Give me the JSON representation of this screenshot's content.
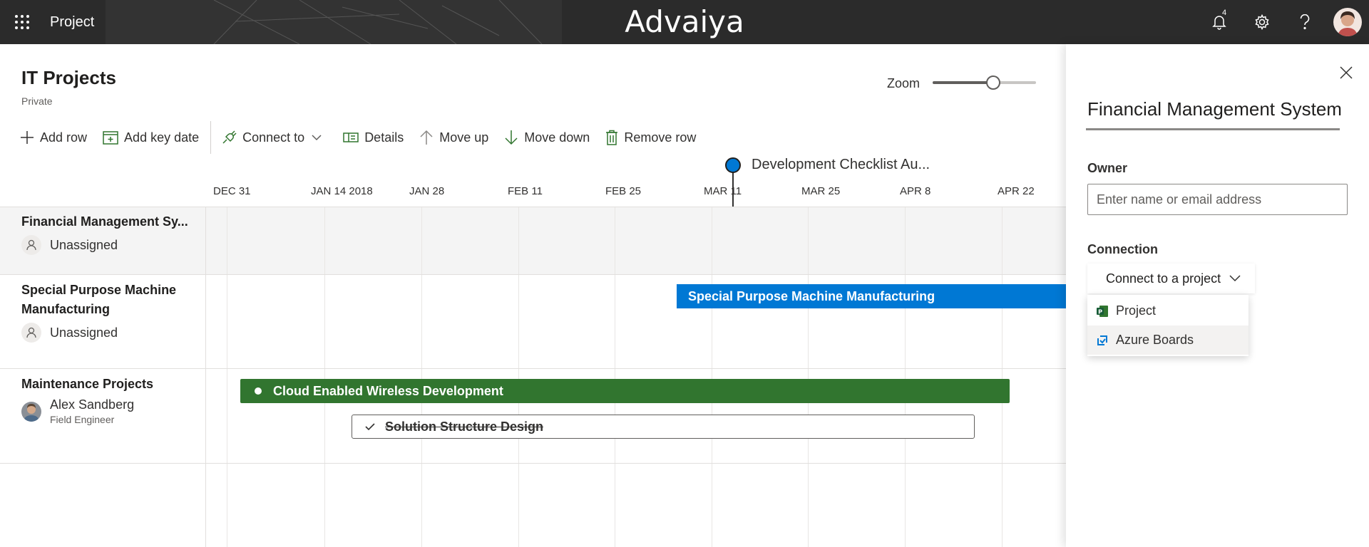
{
  "app": {
    "name": "Project",
    "logo": "Advaiya",
    "notification_count": "4"
  },
  "header": {
    "title": "IT Projects",
    "subtitle": "Private",
    "zoom_label": "Zoom",
    "zoom_level": 0.6
  },
  "toolbar": {
    "add_row": "Add row",
    "add_key_date": "Add key date",
    "connect_to": "Connect to",
    "details": "Details",
    "move_up": "Move up",
    "move_down": "Move down",
    "remove_row": "Remove row"
  },
  "timeline": {
    "milestone": "Development Checklist Au...",
    "dates": [
      "DEC 31",
      "JAN 14 2018",
      "JAN 28",
      "FEB 11",
      "FEB 25",
      "MAR 11",
      "MAR 25",
      "APR 8",
      "APR 22"
    ]
  },
  "rows": [
    {
      "title": "Financial Management Sy...",
      "assignee": "Unassigned"
    },
    {
      "title_line1": "Special Purpose Machine",
      "title_line2": "Manufacturing",
      "assignee": "Unassigned",
      "bar": "Special Purpose Machine Manufacturing"
    },
    {
      "title": "Maintenance Projects",
      "assignee": "Alex Sandberg",
      "assignee_role": "Field Engineer",
      "bar": "Cloud Enabled Wireless Development",
      "task": "Solution Structure Design"
    }
  ],
  "panel": {
    "title": "Financial Management System",
    "owner_label": "Owner",
    "owner_placeholder": "Enter name or email address",
    "connection_label": "Connection",
    "connect_button": "Connect to a project",
    "options": [
      "Project",
      "Azure Boards"
    ]
  },
  "colors": {
    "topbar": "#2b2b2b",
    "accent_blue": "#0078d4",
    "bar_green": "#31752f"
  }
}
